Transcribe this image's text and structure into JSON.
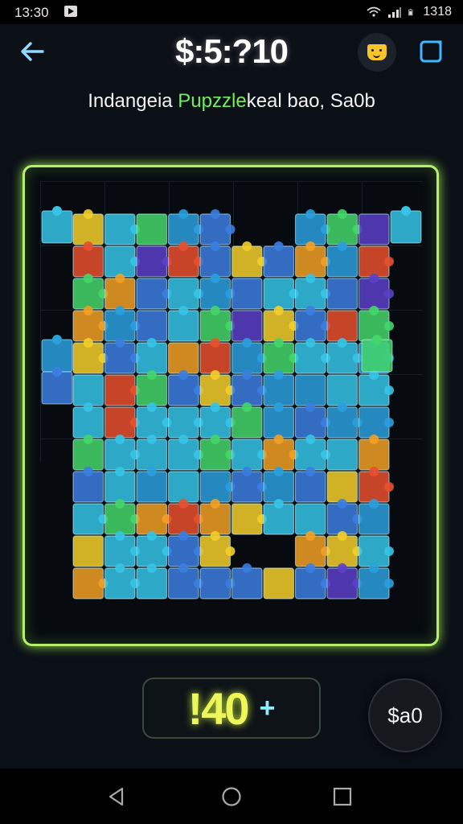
{
  "status_bar": {
    "time": "13:30",
    "right_text": "1318"
  },
  "header": {
    "score": "$:5:?10",
    "subtitle_part1": "Indangeia ",
    "subtitle_part2": "Pupzzle",
    "subtitle_part3": "keal bao, Sa0b"
  },
  "bottom": {
    "coins": "!40",
    "plus": "+",
    "shop_label": "$a0"
  },
  "colors": {
    "board_border": "#b8ef6a",
    "coin_text": "#eef75a",
    "piece_palette": [
      "#35c4e8",
      "#2aa0de",
      "#3b7ee0",
      "#44d66a",
      "#f2a024",
      "#e8502e",
      "#f4cf2a",
      "#5a40c8"
    ]
  },
  "icons": [
    "back-arrow-icon",
    "hint-face-icon",
    "menu-square-icon",
    "nav-back-icon",
    "nav-home-icon",
    "nav-recents-icon"
  ]
}
